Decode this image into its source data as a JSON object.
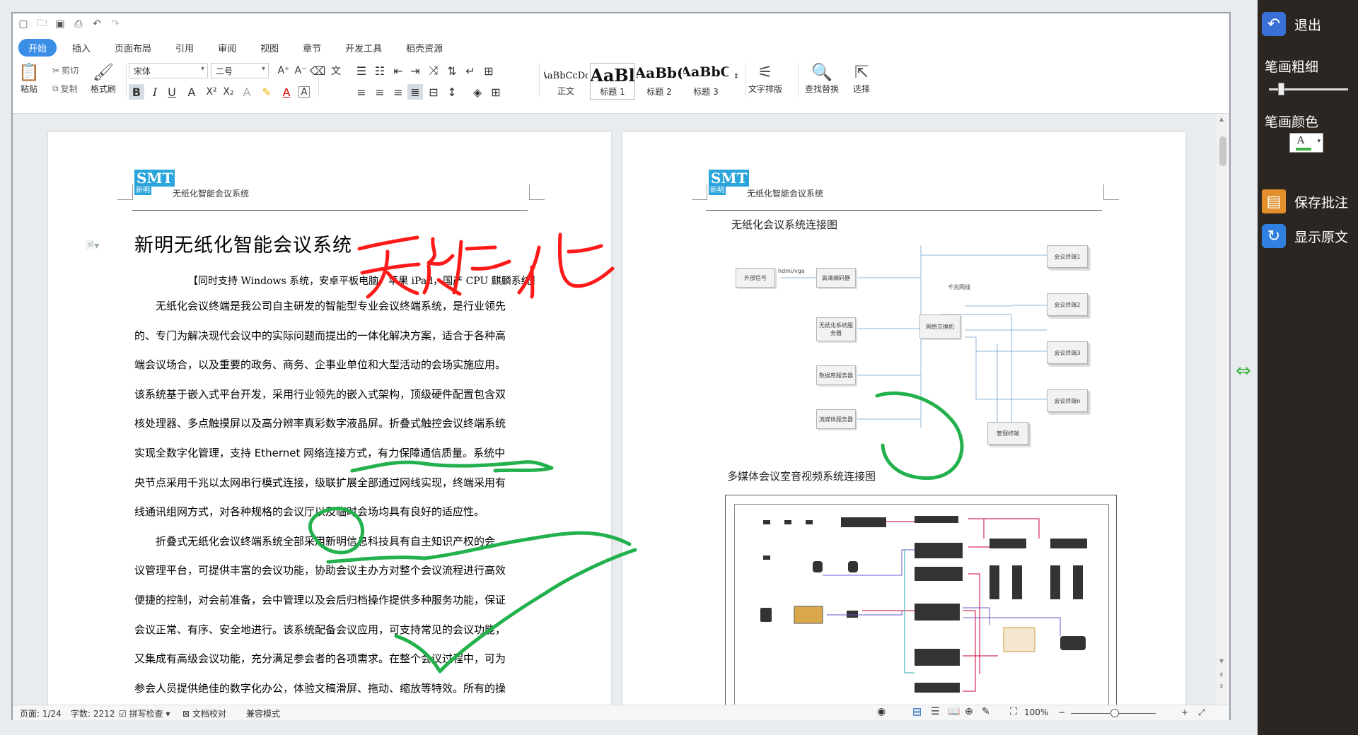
{
  "toolbar": {
    "tabs": [
      "开始",
      "插入",
      "页面布局",
      "引用",
      "审阅",
      "视图",
      "章节",
      "开发工具",
      "稻壳资源"
    ],
    "paste": "粘贴",
    "cut": "剪切",
    "copy": "复制",
    "format_painter": "格式刷",
    "font": "宋体",
    "size": "二号",
    "styles": [
      {
        "preview": "AaBbCcDd",
        "caption": "正文"
      },
      {
        "preview": "AaBl",
        "caption": "标题 1"
      },
      {
        "preview": "AaBb(",
        "caption": "标题 2"
      },
      {
        "preview": "AaBbC",
        "caption": "标题 3"
      }
    ],
    "text_layout": "文字排版",
    "find_replace": "查找替换",
    "select": "选择"
  },
  "page1": {
    "logo": "SMT",
    "logo_sub": "新明",
    "header": "无纸化智能会议系统",
    "title": "新明无纸化智能会议系统",
    "subtitle": "【同时支持 Windows 系统，安卓平板电脑，苹果 iPad，国产 CPU 麒麟系统】",
    "lines": [
      "　　无纸化会议终端是我公司自主研发的智能型专业会议终端系统，是行业领先",
      "的、专门为解决现代会议中的实际问题而提出的一体化解决方案，适合于各种高",
      "端会议场合，以及重要的政务、商务、企事业单位和大型活动的会场实施应用。",
      "该系统基于嵌入式平台开发，采用行业领先的嵌入式架构，顶级硬件配置包含双",
      "核处理器、多点触摸屏以及高分辨率真彩数字液晶屏。折叠式触控会议终端系统",
      "实现全数字化管理，支持 Ethernet 网络连接方式，有力保障通信质量。系统中",
      "央节点采用千兆以太网串行模式连接，级联扩展全部通过网线实现，终端采用有",
      "线通讯组网方式，对各种规格的会议厅以及临时会场均具有良好的适应性。",
      "　　折叠式无纸化会议终端系统全部采用新明信息科技具有自主知识产权的会",
      "议管理平台，可提供丰富的会议功能，协助会议主办方对整个会议流程进行高效",
      "便捷的控制，对会前准备，会中管理以及会后归档操作提供多种服务功能，保证",
      "会议正常、有序、安全地进行。该系统配备会议应用，可支持常见的会议功能，",
      "又集成有高级会议功能，充分满足参会者的各项需求。在整个会议过程中，可为",
      "参会人员提供绝佳的数字化办公，体验文稿滑屏、拖动、缩放等特效。所有的操"
    ]
  },
  "page2": {
    "logo": "SMT",
    "logo_sub": "新明",
    "header": "无纸化智能会议系统",
    "diagram1_title": "无纸化会议系统连接图",
    "diagram2_title": "多媒体会议室音视频系统连接图",
    "net": {
      "external": "外部信号",
      "hdmi": "hdmi/vga",
      "encoder": "高清编码器",
      "server": "无纸化系统服务器",
      "db": "数据库服务器",
      "stream": "流媒体服务器",
      "switch": "网络交换机",
      "gigabit": "千兆网线",
      "terminals": [
        "会议终端1",
        "会议终端2",
        "会议终端3",
        "会议终端n"
      ],
      "manager": "管理终端"
    }
  },
  "status": {
    "page": "页面: 1/24",
    "words": "字数: 2212",
    "spell": "拼写检查",
    "proof": "文档校对",
    "compat": "兼容模式",
    "zoom": "100%"
  },
  "panel": {
    "exit": "退出",
    "stroke_width": "笔画粗细",
    "stroke_color": "笔画颜色",
    "save": "保存批注",
    "show_original": "显示原文",
    "stroke_width_level": 0.15,
    "color_letter": "A"
  },
  "colors": {
    "accent": "#3a8ee6",
    "panel": "#2b2622",
    "ink_red": "#ff1a1a",
    "ink_green": "#22b14c"
  }
}
